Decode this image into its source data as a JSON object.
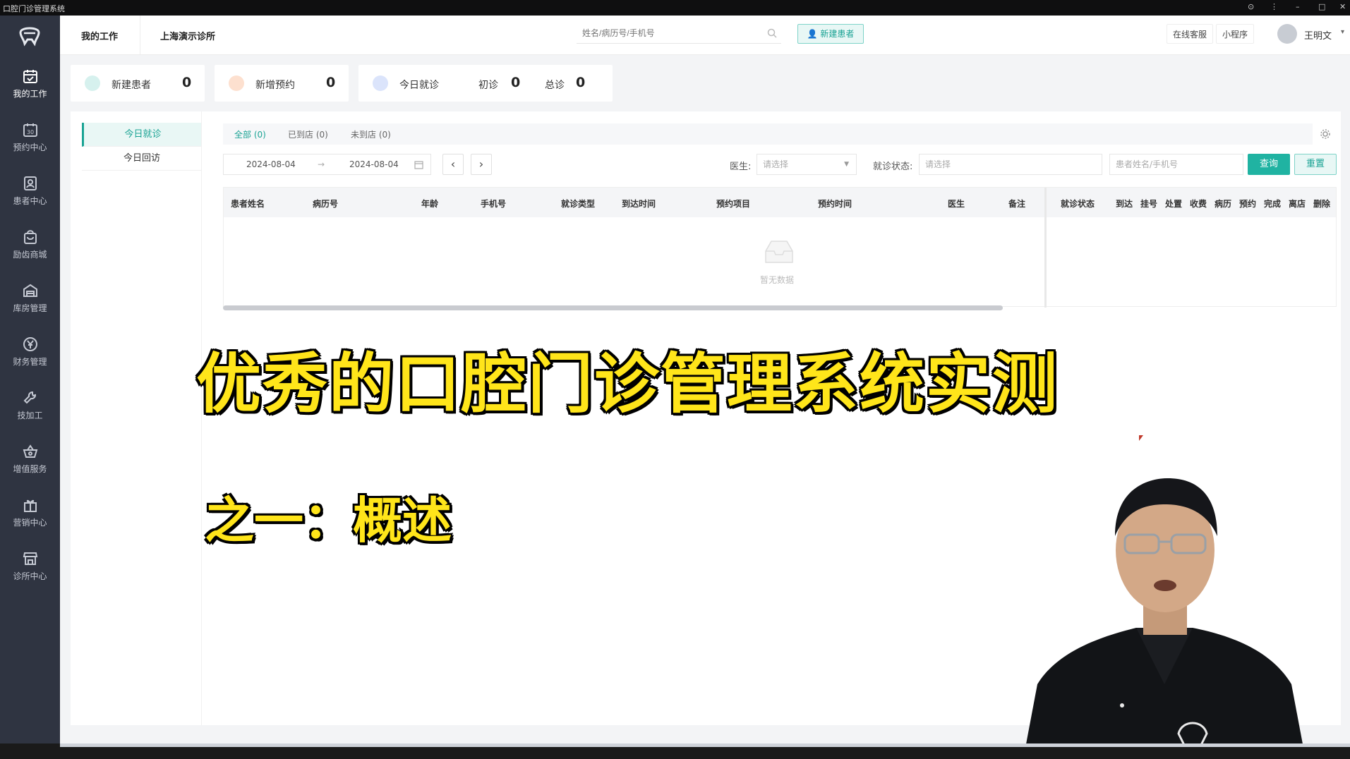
{
  "os_bar": {
    "title": "口腔门诊管理系统"
  },
  "sidebar": {
    "items": [
      {
        "label": "我的工作",
        "icon": "calendar-check-icon"
      },
      {
        "label": "预约中心",
        "icon": "calendar-30-icon"
      },
      {
        "label": "患者中心",
        "icon": "patient-card-icon"
      },
      {
        "label": "励齿商城",
        "icon": "shopping-bag-icon"
      },
      {
        "label": "库房管理",
        "icon": "warehouse-icon"
      },
      {
        "label": "财务管理",
        "icon": "yen-coin-icon"
      },
      {
        "label": "技加工",
        "icon": "wrench-icon"
      },
      {
        "label": "增值服务",
        "icon": "basket-icon"
      },
      {
        "label": "营销中心",
        "icon": "gift-icon"
      },
      {
        "label": "诊所中心",
        "icon": "store-icon"
      }
    ]
  },
  "header": {
    "tab_my_work": "我的工作",
    "tab_clinic": "上海演示诊所",
    "search_placeholder": "姓名/病历号/手机号",
    "new_patient_label": "新建患者",
    "online_service": "在线客服",
    "mini_program": "小程序",
    "username": "王明文"
  },
  "stats": {
    "new_patient_label": "新建患者",
    "new_patient_value": "0",
    "new_appt_label": "新增预约",
    "new_appt_value": "0",
    "today_visit_label": "今日就诊",
    "first_visit_label": "初诊",
    "first_visit_value": "0",
    "total_visit_label": "总诊",
    "total_visit_value": "0"
  },
  "subnav": {
    "today_visit": "今日就诊",
    "today_followup": "今日回访"
  },
  "tabs": {
    "all": "全部 (0)",
    "arrived": "已到店 (0)",
    "not_arrived": "未到店 (0)"
  },
  "filters": {
    "date_start": "2024-08-04",
    "date_sep": "→",
    "date_end": "2024-08-04",
    "doctor_label": "医生:",
    "doctor_placeholder": "请选择",
    "status_label": "就诊状态:",
    "status_placeholder": "请选择",
    "keyword_placeholder": "患者姓名/手机号",
    "query_label": "查询",
    "reset_label": "重置"
  },
  "table": {
    "columns": [
      "患者姓名",
      "病历号",
      "年龄",
      "手机号",
      "就诊类型",
      "到达时间",
      "预约项目",
      "预约时间",
      "医生",
      "备注",
      "就诊状态",
      "到达",
      "挂号",
      "处置",
      "收费",
      "病历",
      "预约",
      "完成",
      "离店",
      "删除"
    ],
    "empty_text": "暂无数据"
  },
  "overlay": {
    "title": "优秀的口腔门诊管理系统实测",
    "subtitle": "之一：概述"
  },
  "colors": {
    "accent": "#1aa394",
    "sidebar_bg": "#2f3441",
    "title_yellow": "#ffe51a"
  }
}
